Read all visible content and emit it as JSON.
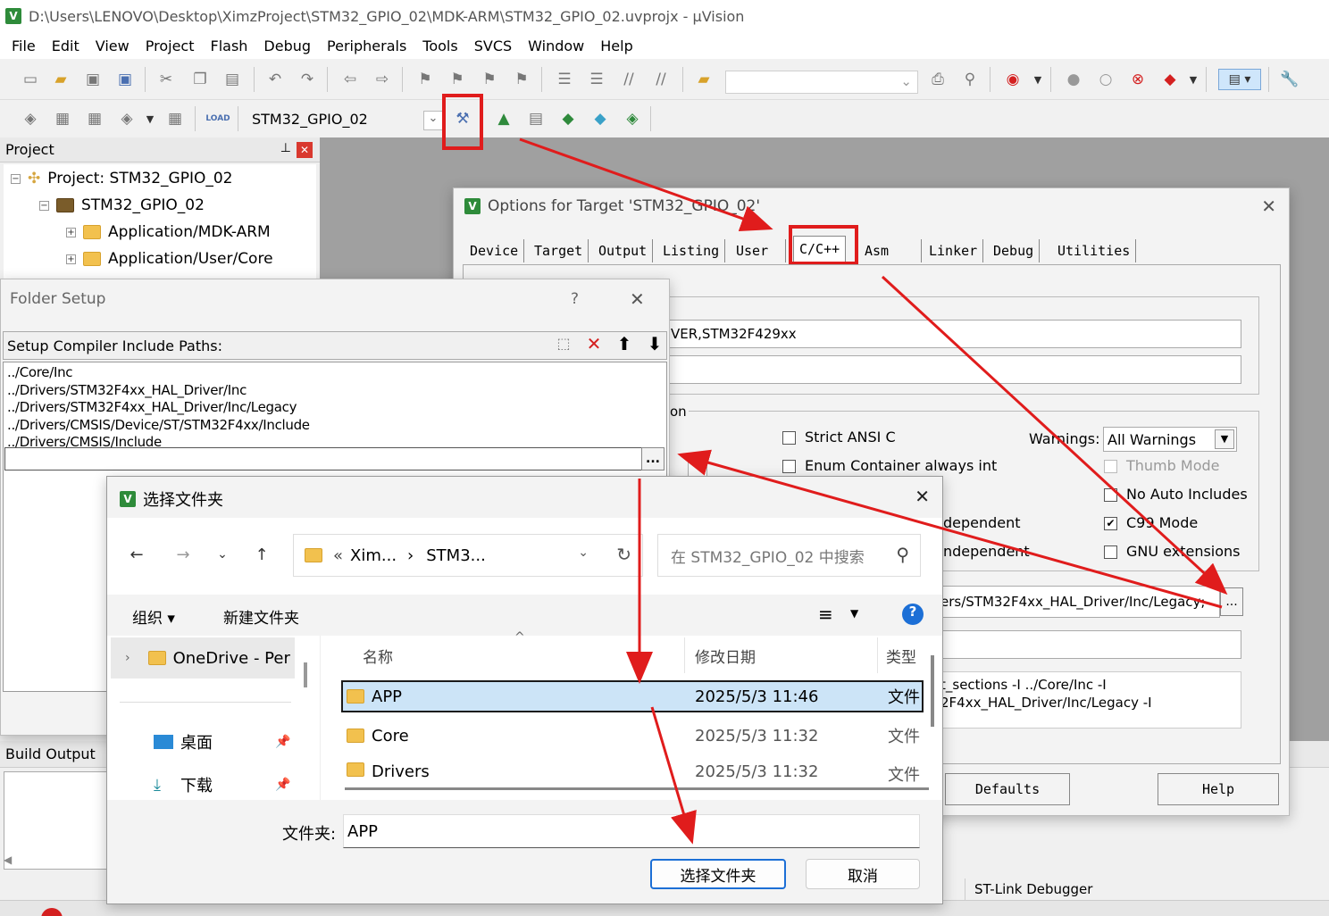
{
  "window": {
    "title": "D:\\Users\\LENOVO\\Desktop\\XimzProject\\STM32_GPIO_02\\MDK-ARM\\STM32_GPIO_02.uvprojx - µVision",
    "icon": "uvision-icon"
  },
  "menu": [
    "File",
    "Edit",
    "View",
    "Project",
    "Flash",
    "Debug",
    "Peripherals",
    "Tools",
    "SVCS",
    "Window",
    "Help"
  ],
  "toolbar2": {
    "target_name": "STM32_GPIO_02",
    "load_label": "LOAD"
  },
  "project_panel": {
    "title": "Project",
    "tree": [
      "Project: STM32_GPIO_02",
      "STM32_GPIO_02",
      "Application/MDK-ARM",
      "Application/User/Core"
    ]
  },
  "build_output": {
    "title": "Build Output"
  },
  "status": {
    "debugger": "ST-Link Debugger"
  },
  "options_dialog": {
    "title": "Options for Target 'STM32_GPIO_02'",
    "tabs": [
      "Device",
      "Target",
      "Output",
      "Listing",
      "User",
      "C/C++",
      "Asm",
      "Linker",
      "Debug",
      "Utilities"
    ],
    "define_text": "VER,STM32F429xx",
    "group_label_fragment": "on",
    "strict_ansi": "Strict ANSI C",
    "enum_container": "Enum Container always int",
    "warnings_label": "Warnings:",
    "warnings_value": "All Warnings",
    "thumb_mode": "Thumb Mode",
    "no_auto_includes": "No Auto Includes",
    "c99_mode": "C99 Mode",
    "gnu_ext": "GNU extensions",
    "dependent_1": "dependent",
    "dependent_2": "ndependent",
    "include_paths": "ers/STM32F4xx_HAL_Driver/Inc/Legacy;",
    "browse_label": "...",
    "compiler_line1": "t_sections -I ../Core/Inc -I",
    "compiler_line2": "2F4xx_HAL_Driver/Inc/Legacy -I",
    "defaults_btn": "Defaults",
    "help_btn": "Help"
  },
  "folder_setup": {
    "title": "Folder Setup",
    "help": "?",
    "label": "Setup Compiler Include Paths:",
    "paths": [
      "../Core/Inc",
      "../Drivers/STM32F4xx_HAL_Driver/Inc",
      "../Drivers/STM32F4xx_HAL_Driver/Inc/Legacy",
      "../Drivers/CMSIS/Device/ST/STM32F4xx/Include",
      "../Drivers/CMSIS/Include"
    ],
    "browse_label": "..."
  },
  "file_dialog": {
    "title": "选择文件夹",
    "breadcrumb": [
      "«",
      "Xim...",
      "›",
      "STM3..."
    ],
    "search_placeholder": "在 STM32_GPIO_02 中搜索",
    "organize": "组织 ▾",
    "new_folder": "新建文件夹",
    "nav": [
      {
        "label": "OneDrive - Per"
      },
      {
        "label": "桌面"
      },
      {
        "label": "下载"
      }
    ],
    "columns": [
      "名称",
      "修改日期",
      "类型"
    ],
    "rows": [
      {
        "name": "APP",
        "date": "2025/5/3 11:46",
        "type": "文件"
      },
      {
        "name": "Core",
        "date": "2025/5/3 11:32",
        "type": "文件"
      },
      {
        "name": "Drivers",
        "date": "2025/5/3 11:32",
        "type": "文件"
      }
    ],
    "folder_label": "文件夹:",
    "folder_value": "APP",
    "select_btn": "选择文件夹",
    "cancel_btn": "取消"
  },
  "annotation_color": "#e01c1c"
}
